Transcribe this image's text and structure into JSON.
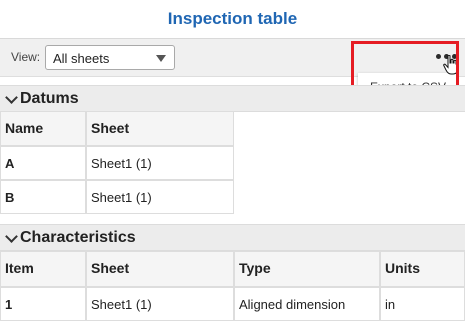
{
  "header": {
    "title": "Inspection table"
  },
  "toolbar": {
    "view_label": "View:",
    "view_value": "All sheets",
    "more_icon": "ellipsis-icon",
    "menu": {
      "export_label": "Export to CSV"
    }
  },
  "datums": {
    "section_label": "Datums",
    "columns": [
      "Name",
      "Sheet"
    ],
    "rows": [
      [
        "A",
        "Sheet1 (1)"
      ],
      [
        "B",
        "Sheet1 (1)"
      ]
    ]
  },
  "characteristics": {
    "section_label": "Characteristics",
    "columns": [
      "Item",
      "Sheet",
      "Type",
      "Units"
    ],
    "rows": [
      [
        "1",
        "Sheet1 (1)",
        "Aligned dimension",
        "in"
      ]
    ]
  },
  "colors": {
    "accent": "#1f66b3",
    "highlight": "#e51c23"
  }
}
